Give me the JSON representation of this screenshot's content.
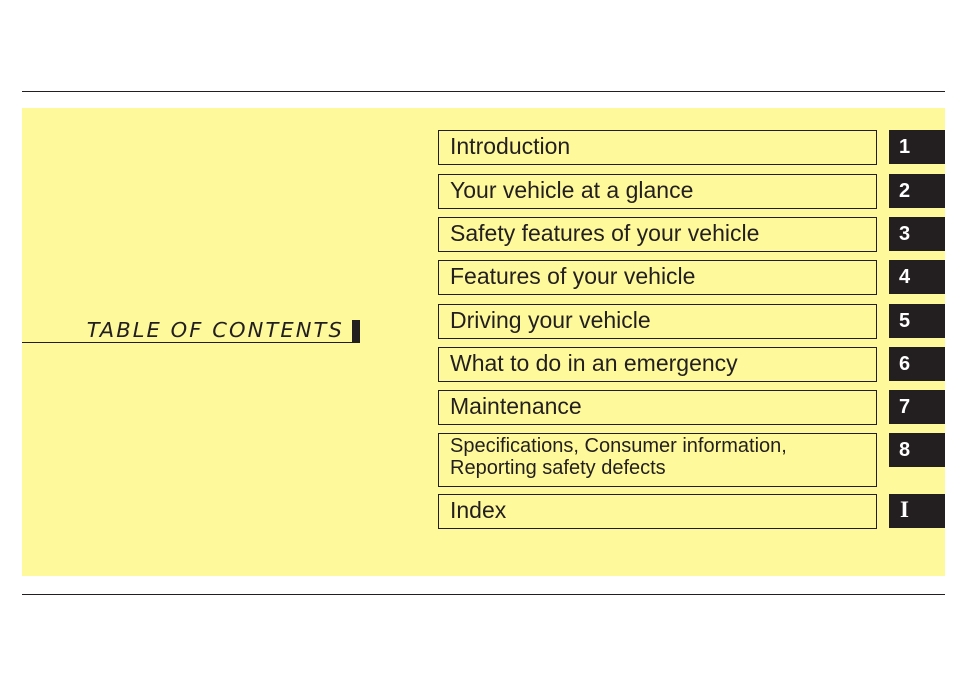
{
  "title": "TABLE OF CONTENTS",
  "colors": {
    "panel_background": "#fef99a",
    "ink": "#231f20",
    "tab_text": "#ffffff"
  },
  "chapters": [
    {
      "label": "Introduction",
      "tab": "1"
    },
    {
      "label": "Your vehicle at a glance",
      "tab": "2"
    },
    {
      "label": "Safety features of your vehicle",
      "tab": "3"
    },
    {
      "label": "Features of your vehicle",
      "tab": "4"
    },
    {
      "label": "Driving your vehicle",
      "tab": "5"
    },
    {
      "label": "What to do in an emergency",
      "tab": "6"
    },
    {
      "label": "Maintenance",
      "tab": "7"
    },
    {
      "label": "Specifications, Consumer information,",
      "label_line2": "Reporting safety defects",
      "tab": "8"
    },
    {
      "label": "Index",
      "tab": "I"
    }
  ]
}
